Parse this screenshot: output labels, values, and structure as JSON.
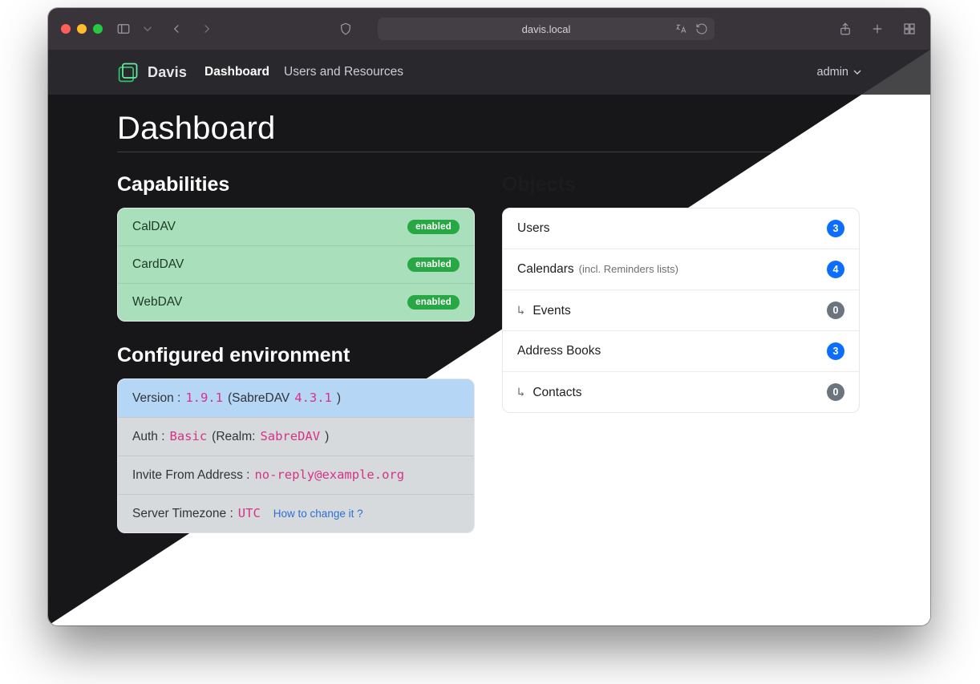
{
  "browser": {
    "url": "davis.local"
  },
  "appnav": {
    "brand": "Davis",
    "links": [
      {
        "label": "Dashboard",
        "active": true
      },
      {
        "label": "Users and Resources",
        "active": false
      }
    ],
    "user": "admin"
  },
  "page": {
    "title": "Dashboard"
  },
  "capabilities": {
    "heading": "Capabilities",
    "items": [
      {
        "name": "CalDAV",
        "status": "enabled"
      },
      {
        "name": "CardDAV",
        "status": "enabled"
      },
      {
        "name": "WebDAV",
        "status": "enabled"
      }
    ]
  },
  "env": {
    "heading": "Configured environment",
    "version_label": "Version :",
    "version": "1.9.1",
    "sabredav_prefix": "(SabreDAV",
    "sabredav_version": "4.3.1",
    "sabredav_suffix": ")",
    "auth_label": "Auth :",
    "auth_method": "Basic",
    "realm_prefix": "(Realm:",
    "realm": "SabreDAV",
    "realm_suffix": ")",
    "invite_label": "Invite From Address :",
    "invite_value": "no-reply@example.org",
    "tz_label": "Server Timezone :",
    "tz_value": "UTC",
    "tz_link": "How to change it ?"
  },
  "objects": {
    "heading": "Objects",
    "items": [
      {
        "label": "Users",
        "count": 3,
        "pill": "blue",
        "child": false
      },
      {
        "label": "Calendars",
        "sublabel": "(incl. Reminders lists)",
        "count": 4,
        "pill": "blue",
        "child": false
      },
      {
        "label": "Events",
        "count": 0,
        "pill": "grey",
        "child": true
      },
      {
        "label": "Address Books",
        "count": 3,
        "pill": "blue",
        "child": false
      },
      {
        "label": "Contacts",
        "count": 0,
        "pill": "grey",
        "child": true
      }
    ]
  }
}
